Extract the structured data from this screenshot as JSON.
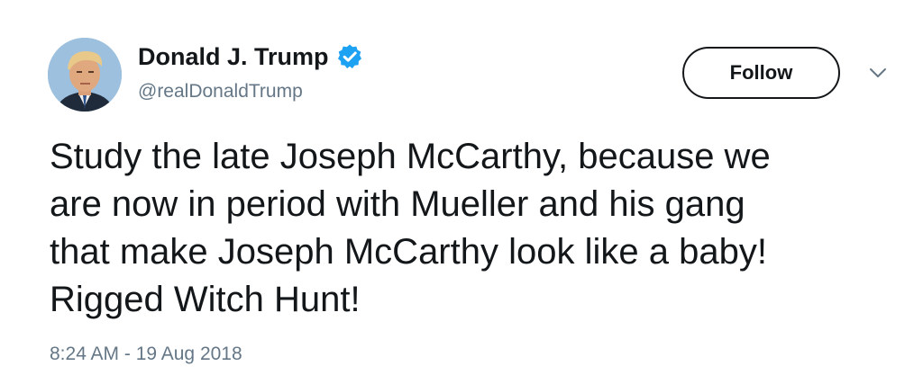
{
  "tweet": {
    "author": {
      "display_name": "Donald J. Trump",
      "handle": "@realDonaldTrump",
      "verified": true,
      "avatar_icon": "profile-photo"
    },
    "follow_label": "Follow",
    "menu_icon": "chevron-down-icon",
    "text": "Study the late Joseph McCarthy, because we\nare now in period with Mueller and his gang\nthat make Joseph McCarthy look like a baby!\nRigged Witch Hunt!",
    "timestamp": "8:24 AM - 19 Aug 2018"
  },
  "colors": {
    "text_primary": "#14171a",
    "text_secondary": "#657786",
    "verified_badge": "#1da1f2",
    "background": "#ffffff"
  }
}
